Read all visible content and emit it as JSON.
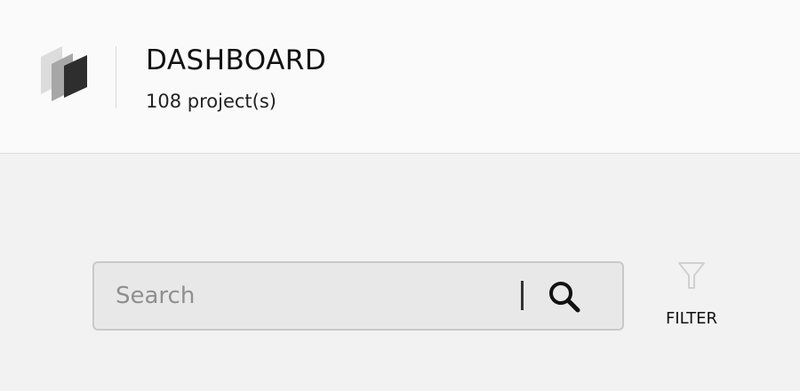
{
  "header": {
    "title": "DASHBOARD",
    "project_count": "108 project(s)",
    "logo_icon": "stacked-layers-logo"
  },
  "search": {
    "placeholder": "Search",
    "value": "",
    "icon": "search-icon"
  },
  "filter": {
    "label": "FILTER",
    "icon": "funnel-icon"
  },
  "colors": {
    "header_bg": "#fafafa",
    "page_bg": "#f2f2f2",
    "search_bg": "#e8e8e8",
    "search_border": "#c9c9c9",
    "filter_icon": "#d0d0d0"
  }
}
